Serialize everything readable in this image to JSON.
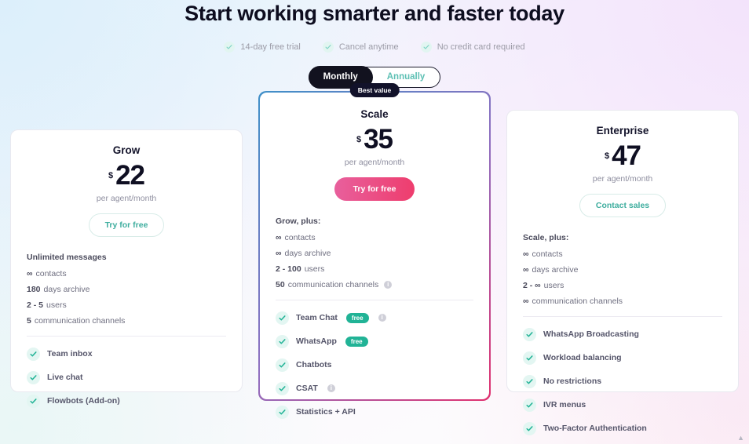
{
  "hero": {
    "title": "Start working smarter and faster today",
    "trust_items": [
      "14-day free trial",
      "Cancel anytime",
      "No credit card required"
    ]
  },
  "billing_toggle": {
    "monthly_label": "Monthly",
    "annually_label": "Annually",
    "selected": "Monthly"
  },
  "best_value_badge": "Best value",
  "currency_symbol": "$",
  "period_label": "per agent/month",
  "scroll_top_glyph": "▲",
  "colors": {
    "primary_cta_start": "#e8609d",
    "primary_cta_end": "#ee3d6d",
    "featured_border_start": "#3f90c8",
    "featured_border_mid": "#8f6fc0",
    "featured_border_end": "#e0316f",
    "check_teal": "#21b396",
    "badge_dark": "#12122a"
  },
  "plans": [
    {
      "id": "grow",
      "name": "Grow",
      "price": "22",
      "cta_label": "Try for free",
      "cta_style": "outline",
      "featured": false,
      "feature_heading": "Unlimited messages",
      "features": [
        {
          "value": "∞",
          "text": "contacts"
        },
        {
          "value": "180",
          "text": "days archive"
        },
        {
          "value": "2 - 5",
          "text": "users"
        },
        {
          "value": "5",
          "text": "communication channels"
        }
      ],
      "checks": [
        {
          "label": "Team inbox",
          "free": false,
          "info": false
        },
        {
          "label": "Live chat",
          "free": false,
          "info": false
        },
        {
          "label": "Flowbots (Add-on)",
          "free": false,
          "info": false
        }
      ]
    },
    {
      "id": "scale",
      "name": "Scale",
      "price": "35",
      "cta_label": "Try for free",
      "cta_style": "primary",
      "featured": true,
      "feature_heading": "Grow, plus:",
      "features": [
        {
          "value": "∞",
          "text": "contacts"
        },
        {
          "value": "∞",
          "text": "days archive"
        },
        {
          "value": "2 - 100",
          "text": "users"
        },
        {
          "value": "50",
          "text": "communication channels",
          "info": true
        }
      ],
      "checks": [
        {
          "label": "Team Chat",
          "free": true,
          "free_label": "free",
          "info": true
        },
        {
          "label": "WhatsApp",
          "free": true,
          "free_label": "free",
          "info": false
        },
        {
          "label": "Chatbots",
          "free": false,
          "info": false
        },
        {
          "label": "CSAT",
          "free": false,
          "info": true
        },
        {
          "label": "Statistics + API",
          "free": false,
          "info": false
        }
      ]
    },
    {
      "id": "enterprise",
      "name": "Enterprise",
      "price": "47",
      "cta_label": "Contact sales",
      "cta_style": "outline",
      "featured": false,
      "feature_heading": "Scale, plus:",
      "features": [
        {
          "value": "∞",
          "text": "contacts"
        },
        {
          "value": "∞",
          "text": "days archive"
        },
        {
          "value": "2 - ∞",
          "text": "users"
        },
        {
          "value": "∞",
          "text": "communication channels"
        }
      ],
      "checks": [
        {
          "label": "WhatsApp Broadcasting",
          "free": false,
          "info": false
        },
        {
          "label": "Workload balancing",
          "free": false,
          "info": false
        },
        {
          "label": "No restrictions",
          "free": false,
          "info": false
        },
        {
          "label": "IVR menus",
          "free": false,
          "info": false
        },
        {
          "label": "Two-Factor Authentication",
          "free": false,
          "info": false
        }
      ]
    }
  ]
}
